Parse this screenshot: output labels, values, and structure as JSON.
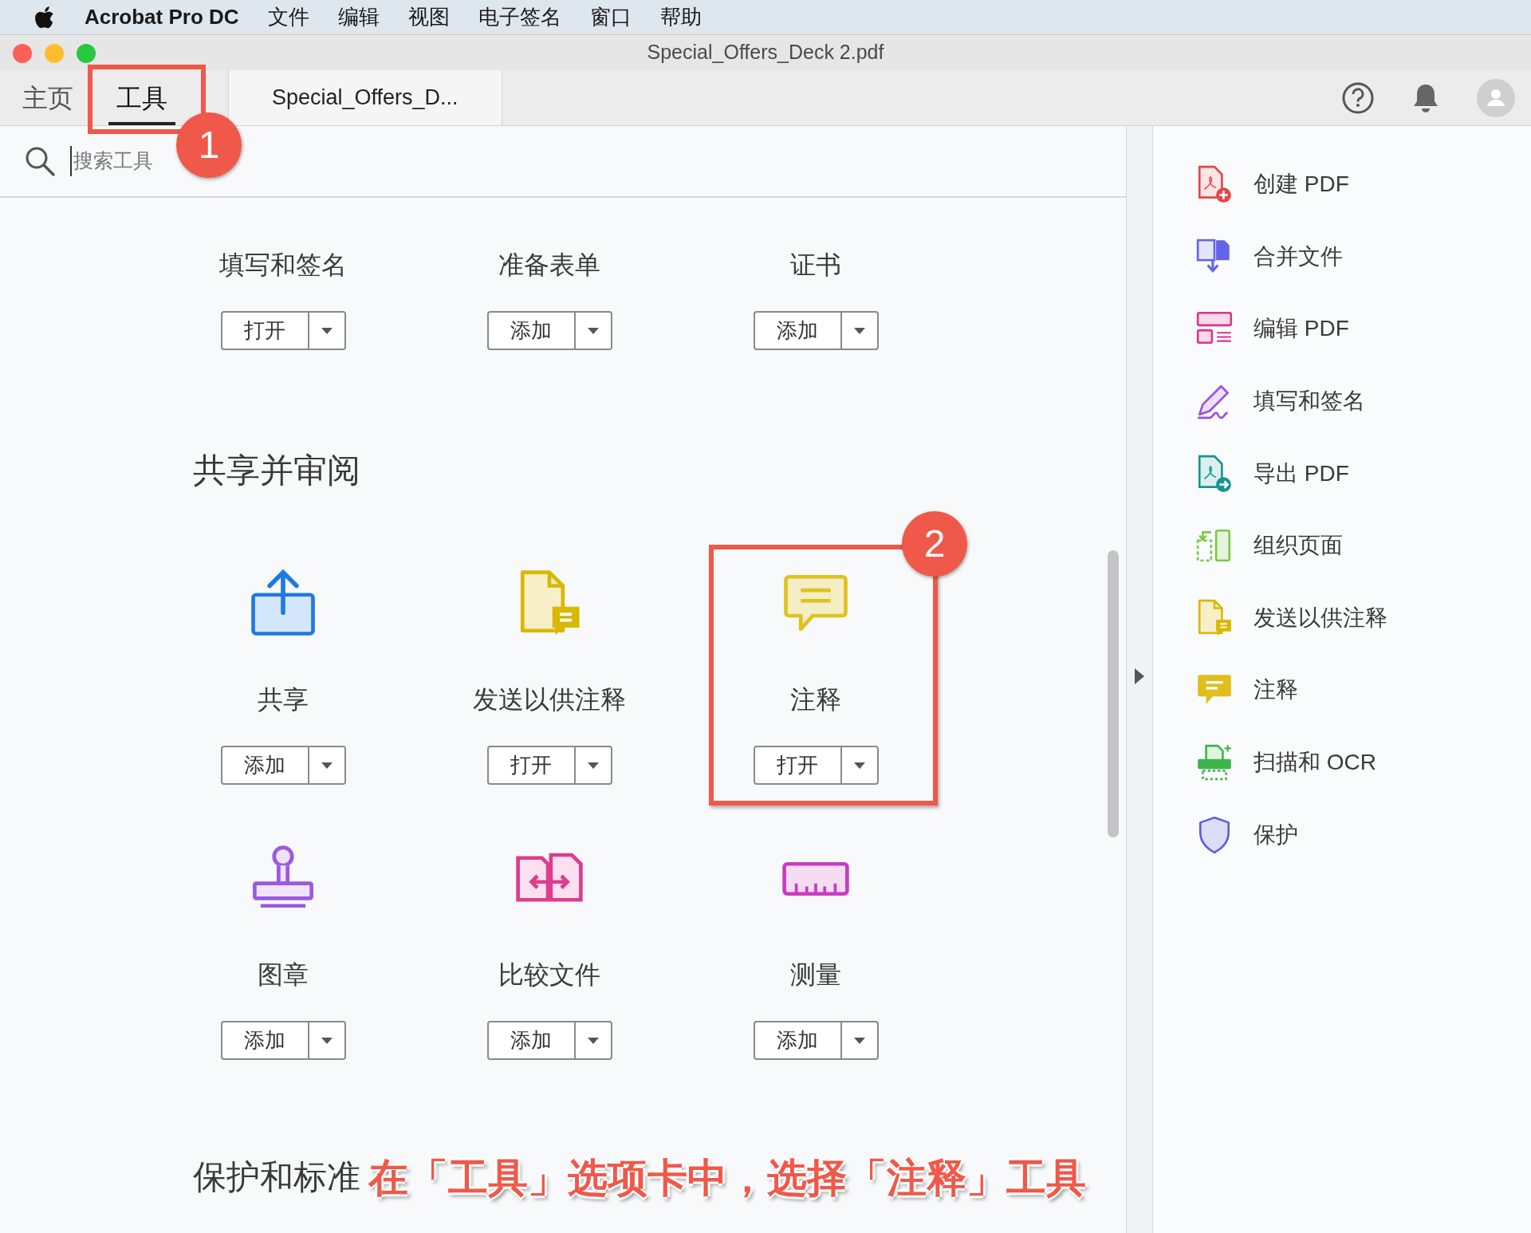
{
  "menu_bar": {
    "app": "Acrobat Pro DC",
    "items": [
      "文件",
      "编辑",
      "视图",
      "电子签名",
      "窗口",
      "帮助"
    ]
  },
  "window": {
    "title": "Special_Offers_Deck 2.pdf"
  },
  "tabs": [
    {
      "label": "主页",
      "selected": false
    },
    {
      "label": "工具",
      "selected": true
    },
    {
      "label": "Special_Offers_D...",
      "selected": false
    }
  ],
  "search": {
    "placeholder": "搜索工具"
  },
  "sections": [
    {
      "tools": [
        {
          "name": "填写和签名",
          "action": "打开"
        },
        {
          "name": "准备表单",
          "action": "添加"
        },
        {
          "name": "证书",
          "action": "添加"
        }
      ]
    },
    {
      "heading": "共享并审阅",
      "tools": [
        {
          "name": "共享",
          "action": "添加",
          "kind": "share"
        },
        {
          "name": "发送以供注释",
          "action": "打开",
          "kind": "send-comment"
        },
        {
          "name": "注释",
          "action": "打开",
          "kind": "comment"
        },
        {
          "name": "图章",
          "action": "添加",
          "kind": "stamp"
        },
        {
          "name": "比较文件",
          "action": "添加",
          "kind": "compare"
        },
        {
          "name": "测量",
          "action": "添加",
          "kind": "measure"
        }
      ]
    },
    {
      "heading": "保护和标准"
    }
  ],
  "sidebar": {
    "items": [
      {
        "label": "创建 PDF",
        "kind": "create-pdf"
      },
      {
        "label": "合并文件",
        "kind": "combine"
      },
      {
        "label": "编辑 PDF",
        "kind": "edit-pdf"
      },
      {
        "label": "填写和签名",
        "kind": "fill-sign"
      },
      {
        "label": "导出 PDF",
        "kind": "export-pdf"
      },
      {
        "label": "组织页面",
        "kind": "organize"
      },
      {
        "label": "发送以供注释",
        "kind": "send-comment"
      },
      {
        "label": "注释",
        "kind": "comment"
      },
      {
        "label": "扫描和 OCR",
        "kind": "scan"
      },
      {
        "label": "保护",
        "kind": "protect"
      }
    ]
  },
  "annotations": [
    {
      "number": "1",
      "kind": "tab"
    },
    {
      "number": "2",
      "kind": "tool"
    }
  ],
  "caption": "在「工具」选项卡中，选择「注释」工具"
}
